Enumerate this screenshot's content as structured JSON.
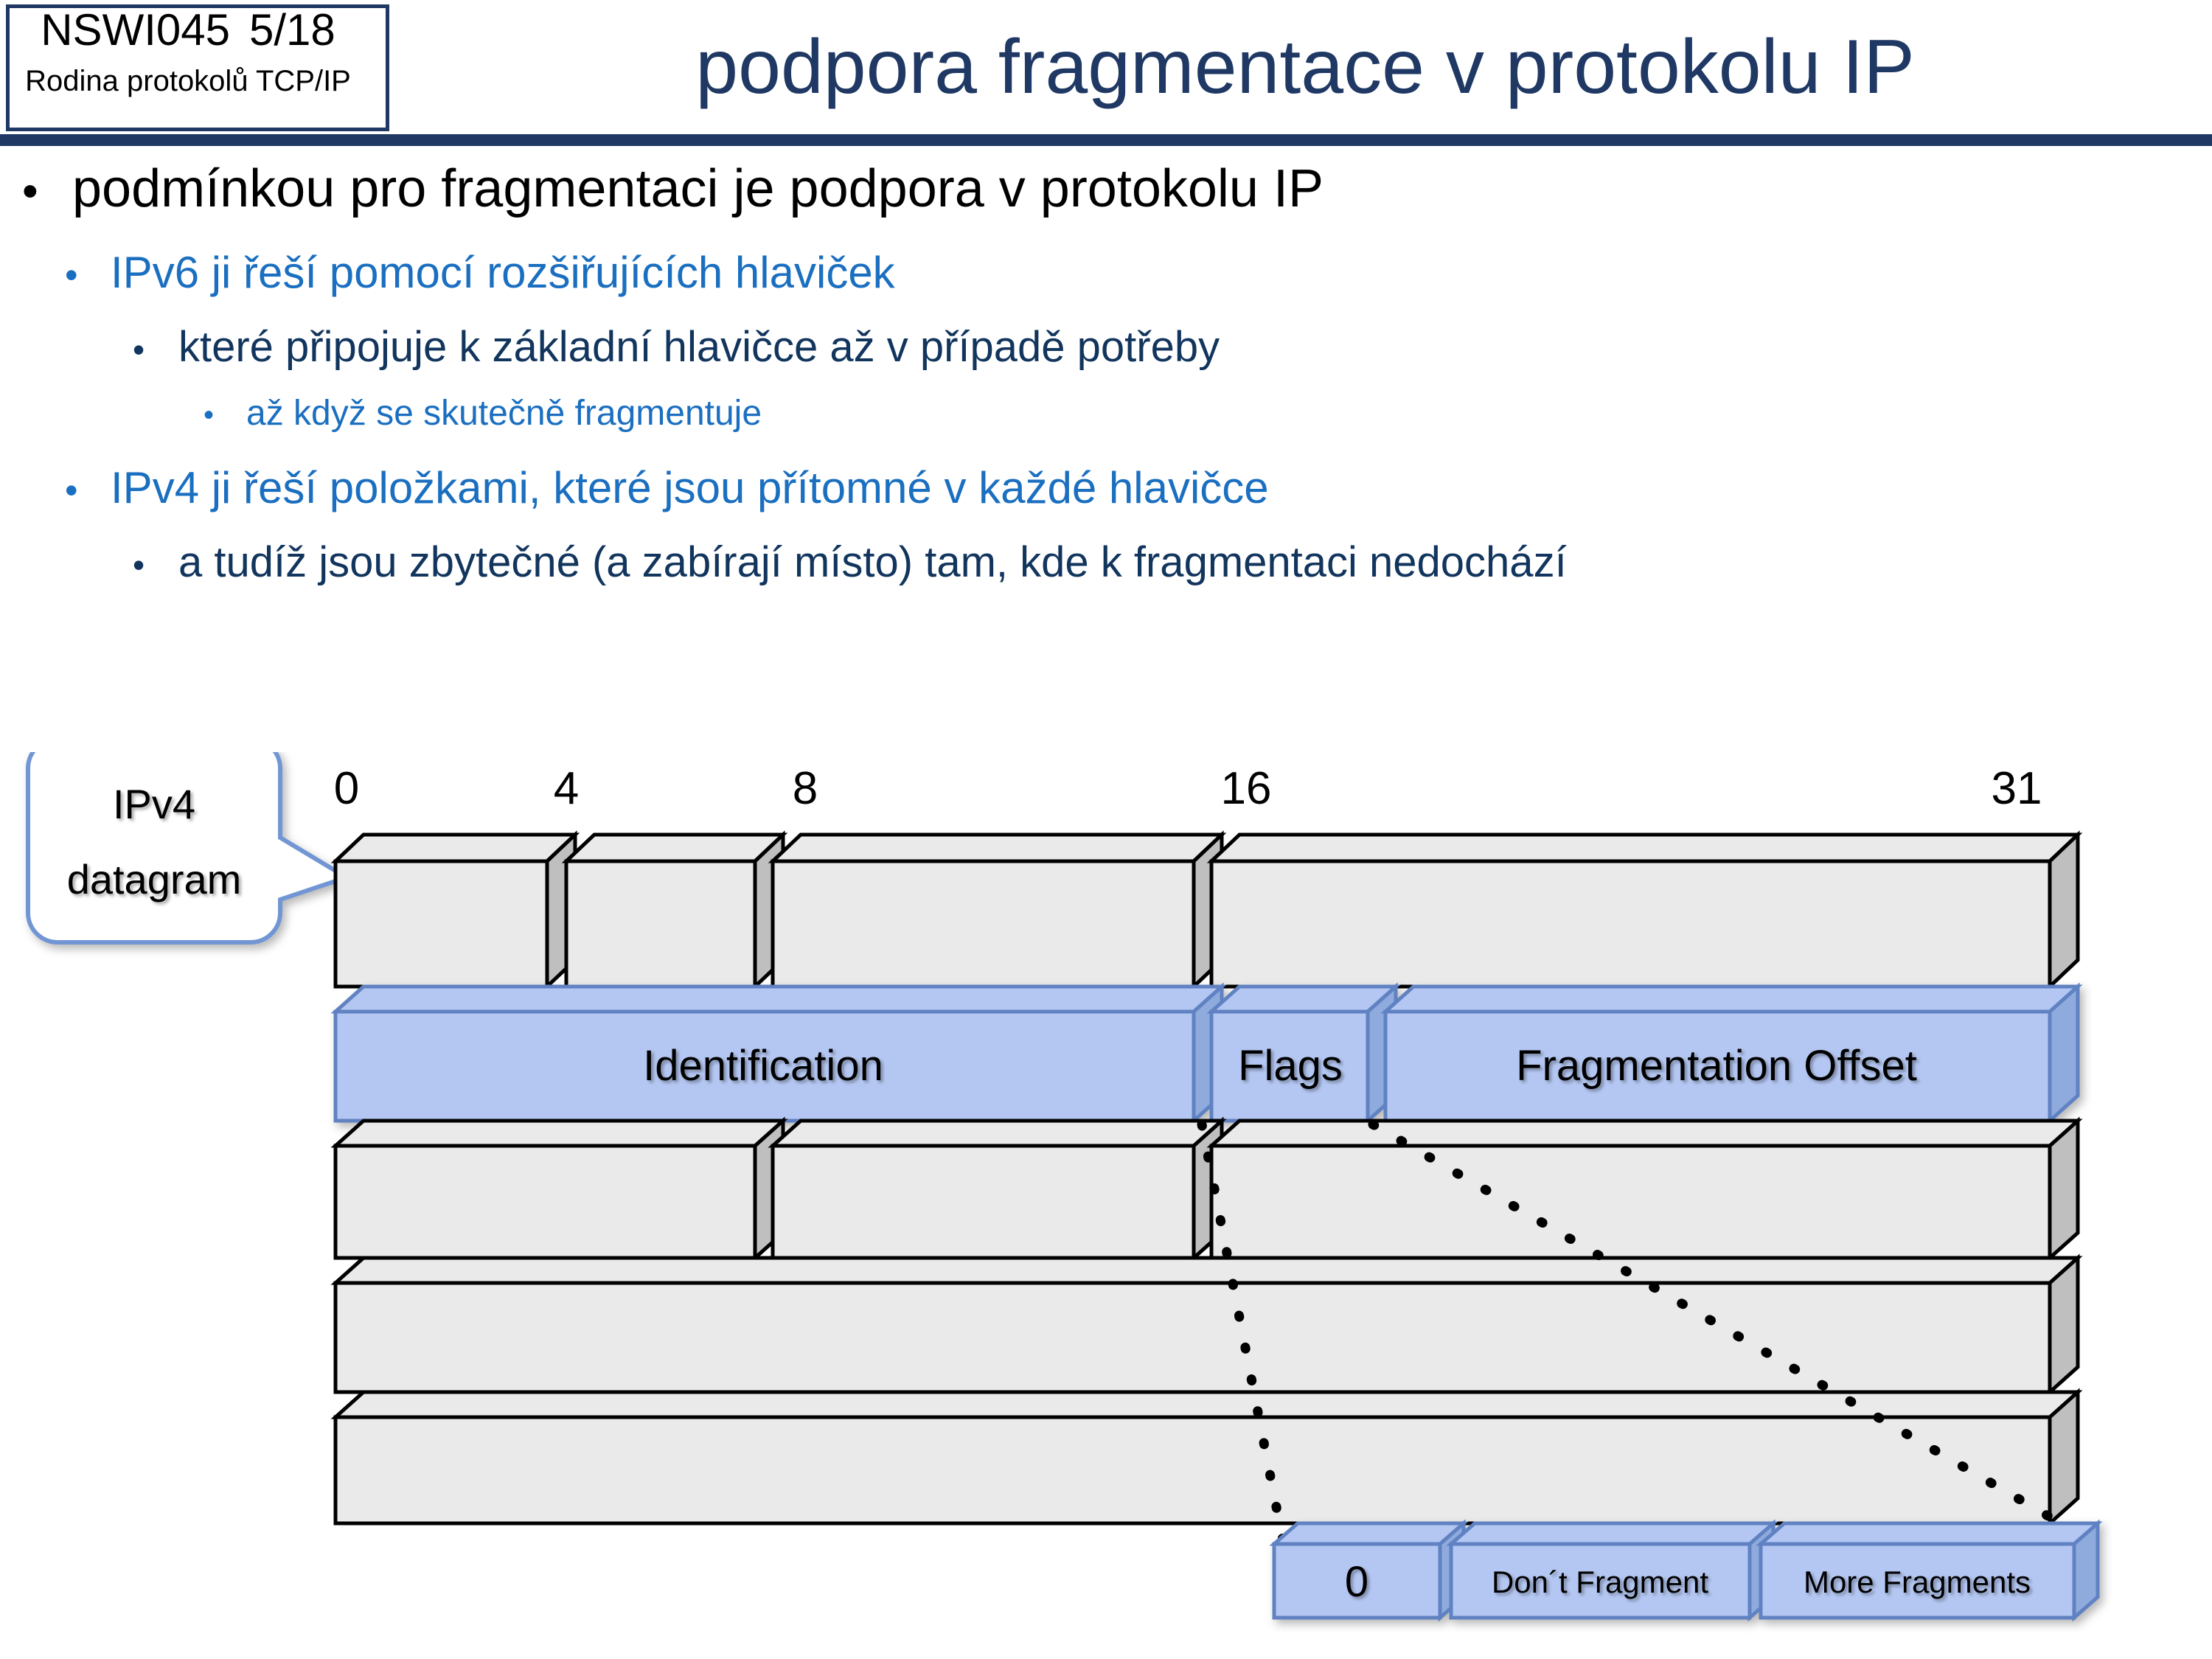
{
  "header": {
    "course_code": "NSWI045",
    "slide_number": "5/18",
    "course_subtitle": "Rodina protokolů TCP/IP",
    "title": "podpora fragmentace v protokolu IP",
    "accent_navy": "#1F3864"
  },
  "bullets": [
    {
      "level": 1,
      "marker": "•",
      "text": "podmínkou pro fragmentaci je podpora v protokolu IP",
      "color": "#000000"
    },
    {
      "level": 2,
      "marker": "•",
      "text": "IPv6 ji řeší pomocí rozšiřujících hlaviček",
      "color": "#1B6FC0"
    },
    {
      "level": 3,
      "marker": "•",
      "text": "které připojuje k základní hlavičce až v případě potřeby",
      "color": "#12355E"
    },
    {
      "level": 4,
      "marker": "•",
      "text": "až když se skutečně fragmentuje",
      "color": "#1B6FC0"
    },
    {
      "level": 2,
      "marker": "•",
      "text": "IPv4 ji řeší položkami, které jsou přítomné v každé hlavičce",
      "color": "#1B6FC0"
    },
    {
      "level": 3,
      "marker": "•",
      "text": "a tudíž jsou zbytečné (a zabírají místo) tam, kde k fragmentaci nedochází",
      "color": "#12355E"
    }
  ],
  "diagram": {
    "callout_line1": "IPv4",
    "callout_line2": "datagram",
    "callout_border_color": "#7296D4",
    "bit_ruler": [
      "0",
      "4",
      "8",
      "16",
      "31"
    ],
    "highlight_fill": "#B4C7F2",
    "highlight_side": "#8FAADC",
    "highlight_border": "#6082C2",
    "plain_fill": "#EAEAEA",
    "plain_side": "#BFBFBF",
    "plain_border": "#000000",
    "highlight_row_fields": [
      {
        "label": "Identification"
      },
      {
        "label": "Flags"
      },
      {
        "label": "Fragmentation Offset"
      }
    ],
    "flag_detail": [
      {
        "label": "0"
      },
      {
        "label": "Don´t  Fragment"
      },
      {
        "label": "More  Fragments"
      }
    ]
  }
}
